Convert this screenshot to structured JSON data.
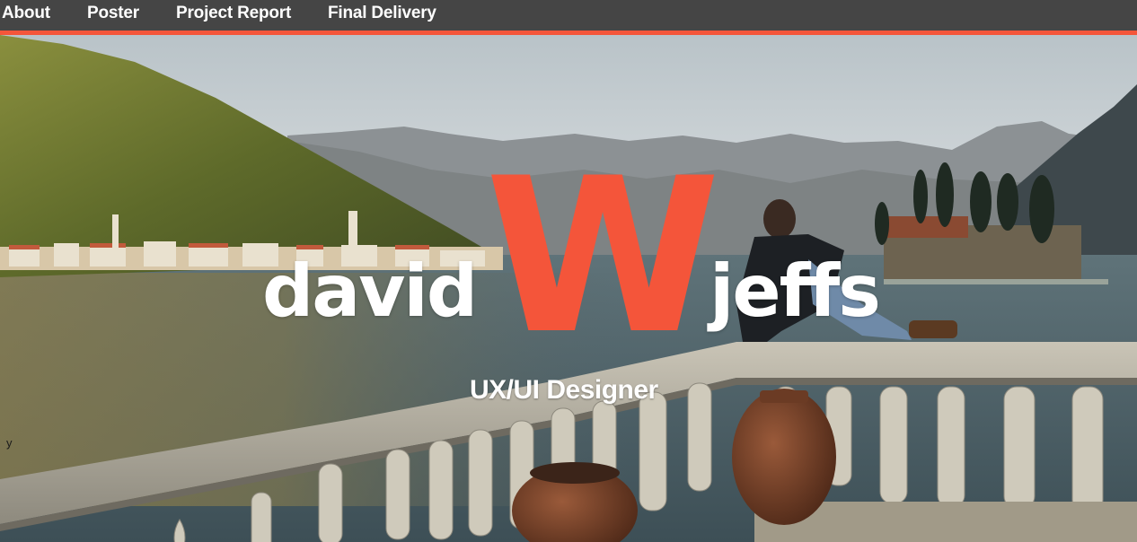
{
  "nav": {
    "items": [
      {
        "label": "About"
      },
      {
        "label": "Poster"
      },
      {
        "label": "Project Report"
      },
      {
        "label": "Final Delivery"
      }
    ]
  },
  "hero": {
    "name_first": "david",
    "monogram": "W",
    "name_last": "jeffs",
    "role": "UX/UI Designer",
    "stray_char": "y"
  },
  "colors": {
    "nav_bg": "#454545",
    "accent": "#f4553a",
    "text": "#ffffff"
  }
}
